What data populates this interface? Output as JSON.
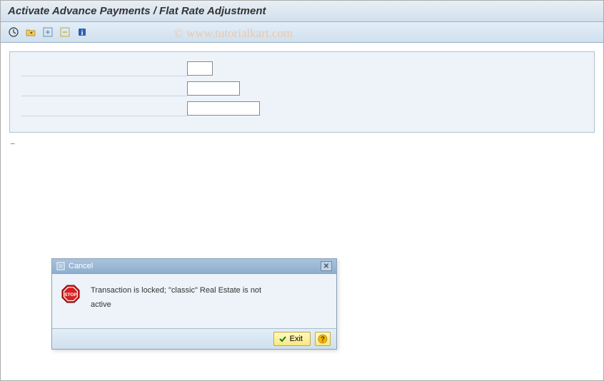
{
  "header": {
    "title": "Activate Advance Payments / Flat Rate Adjustment"
  },
  "watermark": "© www.tutorialkart.com",
  "form": {
    "field1": "",
    "field2": "",
    "field3": ""
  },
  "dialog": {
    "title": "Cancel",
    "message": "Transaction is locked; \"classic\" Real Estate is not active",
    "exit_label": "Exit"
  }
}
